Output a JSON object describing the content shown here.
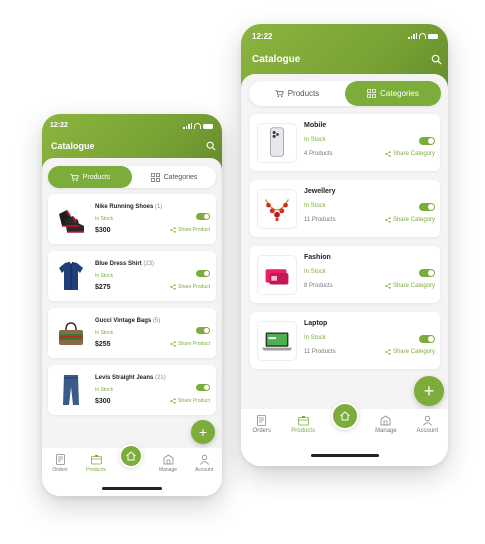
{
  "colors": {
    "accent": "#7cad3a",
    "header_start": "#8bb43f",
    "header_end": "#628a2b"
  },
  "left_phone": {
    "status_time": "12:22",
    "title": "Catalogue",
    "tabs": [
      {
        "label": "Products",
        "active": true
      },
      {
        "label": "Categories",
        "active": false
      }
    ],
    "products": [
      {
        "name": "Nike Running Shoes",
        "count": "(1)",
        "stock": "In Stock",
        "price": "$300",
        "share": "Share Product",
        "icon": "shoes-image"
      },
      {
        "name": "Blue Dress Shirt",
        "count": "(23)",
        "stock": "In Stock",
        "price": "$275",
        "share": "Share Product",
        "icon": "shirt-image"
      },
      {
        "name": "Gucci Vintage Bags",
        "count": "(5)",
        "stock": "In Stock",
        "price": "$255",
        "share": "Share Product",
        "icon": "bag-image"
      },
      {
        "name": "Levis Straight Jeans",
        "count": "(21)",
        "stock": "In Stock",
        "price": "$300",
        "share": "Share Product",
        "icon": "jeans-image"
      }
    ],
    "fab_label": "+",
    "nav": [
      {
        "label": "Orders"
      },
      {
        "label": "Products"
      },
      {
        "label": "Manage"
      },
      {
        "label": "Account"
      }
    ]
  },
  "right_phone": {
    "status_time": "12:22",
    "title": "Catalogue",
    "tabs": [
      {
        "label": "Products",
        "active": false
      },
      {
        "label": "Categories",
        "active": true
      }
    ],
    "categories": [
      {
        "name": "Mobile",
        "stock": "In Stock",
        "products": "4 Products",
        "share": "Share Category",
        "icon": "mobile-image"
      },
      {
        "name": "Jewellery",
        "stock": "In Stock",
        "products": "11 Products",
        "share": "Share Category",
        "icon": "necklace-image"
      },
      {
        "name": "Fashion",
        "stock": "In Stock",
        "products": "8 Products",
        "share": "Share Category",
        "icon": "fashion-image"
      },
      {
        "name": "Laptop",
        "stock": "In Stock",
        "products": "11 Products",
        "share": "Share Category",
        "icon": "laptop-image"
      }
    ],
    "fab_label": "+",
    "nav": [
      {
        "label": "Orders"
      },
      {
        "label": "Products"
      },
      {
        "label": "Manage"
      },
      {
        "label": "Account"
      }
    ]
  }
}
